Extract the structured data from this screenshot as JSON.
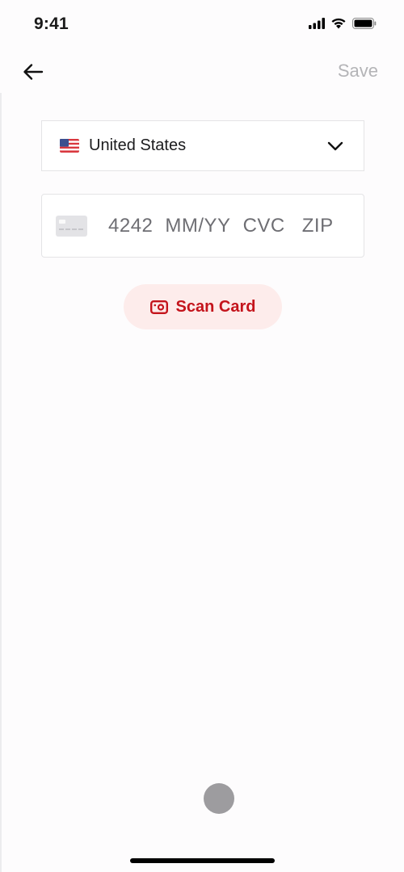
{
  "status_bar": {
    "time": "9:41",
    "icons": [
      "cellular-signal-icon",
      "wifi-icon",
      "battery-icon"
    ]
  },
  "nav": {
    "back_icon": "arrow-left-icon",
    "save_label": "Save"
  },
  "country_select": {
    "flag": "us-flag-icon",
    "selected": "United States",
    "chevron": "chevron-down-icon"
  },
  "card_input": {
    "card_icon": "credit-card-icon",
    "number_placeholder": "4242",
    "expiry_placeholder": "MM/YY",
    "cvc_placeholder": "CVC",
    "zip_placeholder": "ZIP"
  },
  "scan_card": {
    "icon": "camera-icon",
    "label": "Scan Card"
  },
  "colors": {
    "accent": "#c4141c",
    "accent_bg": "#fdeceb",
    "disabled_text": "#b4b4b7",
    "placeholder_text": "#6e6e73"
  }
}
